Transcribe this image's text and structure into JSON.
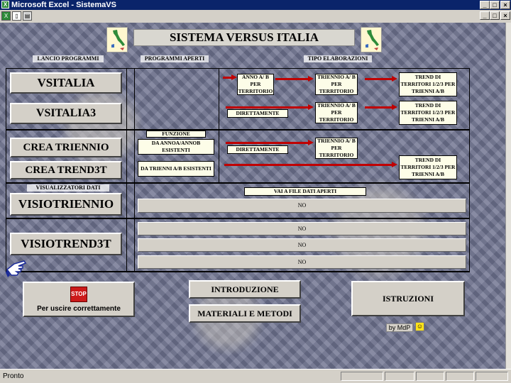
{
  "window": {
    "title": "Microsoft Excel - SistemaVS"
  },
  "toolbar": {
    "icons": [
      "excel-icon",
      "print-preview-icon",
      "print-icon"
    ]
  },
  "status": {
    "text": "Pronto"
  },
  "sheet": {
    "title": "SISTEMA VERSUS ITALIA",
    "headers": {
      "launch": "LANCIO PROGRAMMI",
      "open": "PROGRAMMI APERTI",
      "type": "TIPO ELABORAZIONI"
    },
    "buttons": {
      "vsitalia": "VSITALIA",
      "vsitalia3": "VSITALIA3",
      "crea_triennio": "CREA TRIENNIO",
      "crea_trend3t": "CREA TREND3T",
      "visiotriennio": "VISIOTRIENNIO",
      "visiotrend3t": "VISIOTREND3T",
      "exit": "Per uscire correttamente",
      "stop": "STOP",
      "introduzione": "INTRODUZIONE",
      "materiali": "MATERIALI E METODI",
      "istruzioni": "ISTRUZIONI"
    },
    "labels": {
      "anno_ab": "ANNO A/ B PER TERRITORIO",
      "triennio_ab_1": "TRIENNIO A/ B PER TERRITORIO",
      "trend_1": "TREND DI TERRITORI 1/2/3 PER TRIENNI A/B",
      "direttamente_1": "DIRETTAMENTE",
      "triennio_ab_2": "TRIENNIO A/ B PER TERRITORIO",
      "trend_2": "TREND DI TERRITORI 1/2/3 PER TRIENNI A/B",
      "funzione": "FUNZIONE",
      "da_anno": "DA ANNOA/ANNOB ESISTENTI",
      "da_trienni": "DA TRIENNI A/B ESISTENTI",
      "direttamente_2": "DIRETTAMENTE",
      "triennio_ab_3": "TRIENNIO A/ B PER TERRITORIO",
      "trend_3": "TREND DI TERRITORI 1/2/3 PER TRIENNI A/B",
      "visualizzatori": "VISUALIZZATORI DATI",
      "vai_file": "VAI A FILE DATI APERTI",
      "by_mdp": "by MdP"
    },
    "files": [
      "NO",
      "NO",
      "NO",
      "NO"
    ]
  }
}
